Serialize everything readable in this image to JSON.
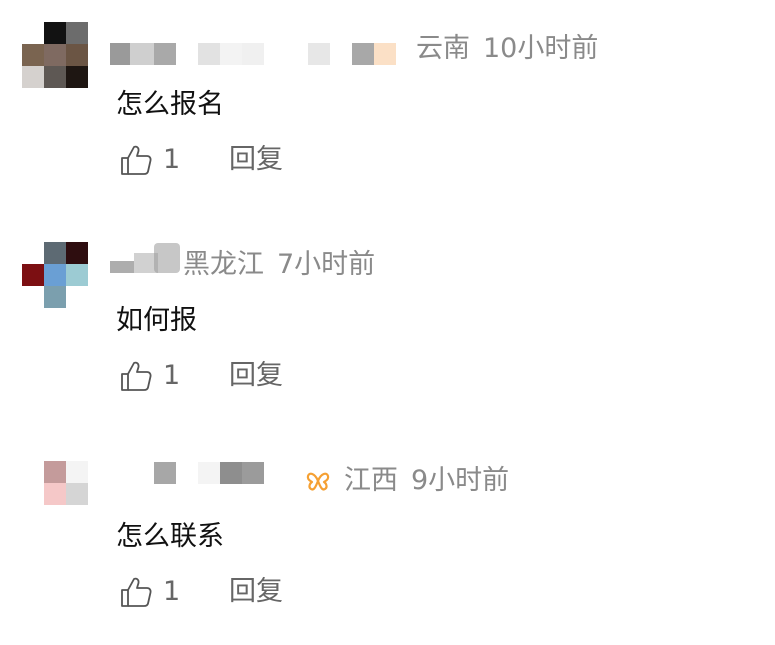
{
  "comments": [
    {
      "location": "云南",
      "time": "10小时前",
      "content": "怎么报名",
      "likes": "1",
      "reply_label": "回复"
    },
    {
      "location": "黑龙江",
      "time": "7小时前",
      "content": "如何报",
      "likes": "1",
      "reply_label": "回复"
    },
    {
      "location": "江西",
      "time": "9小时前",
      "content": "怎么联系",
      "likes": "1",
      "reply_label": "回复",
      "badge_icon": "butterfly-icon",
      "badge_color": "#f5a033"
    }
  ],
  "colors": {
    "meta_text": "#8a8a8a",
    "content_text": "#111111",
    "action_text": "#666666"
  },
  "icons": {
    "like": "thumbs-up-icon"
  }
}
